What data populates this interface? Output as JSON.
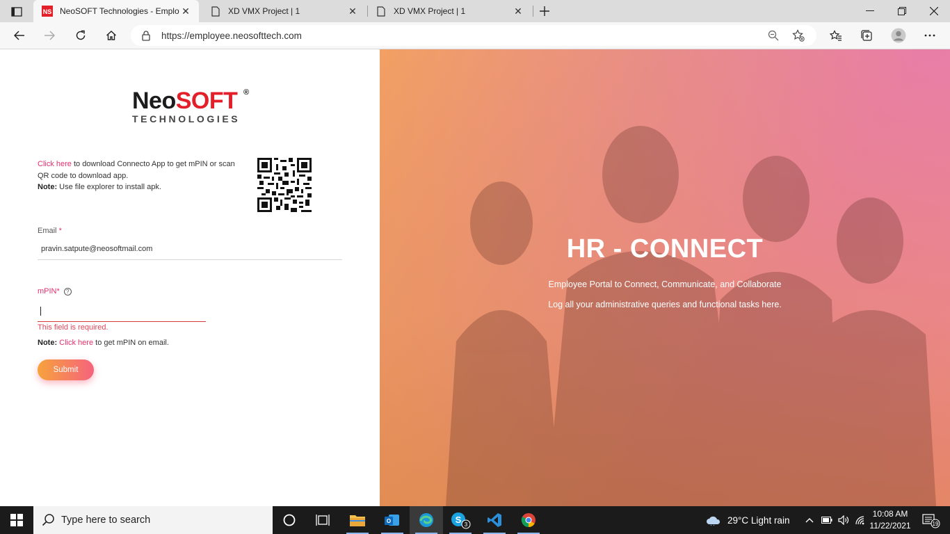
{
  "browser": {
    "tabs": [
      {
        "title": "NeoSOFT Technologies - Employ",
        "favicon_text": "NS",
        "active": true
      },
      {
        "title": "XD VMX Project | 1",
        "active": false
      },
      {
        "title": "XD VMX Project | 1",
        "active": false
      }
    ],
    "url": "https://employee.neosofttech.com"
  },
  "logo": {
    "brand_a": "Neo",
    "brand_b": "SOFT",
    "reg": "®",
    "tagline": "TECHNOLOGIES"
  },
  "download_info": {
    "link": "Click here",
    "text": " to download Connecto App to get mPIN or scan QR code to download app.",
    "note_label": "Note:",
    "note_text": " Use file explorer to install apk."
  },
  "form": {
    "email_label": "Email",
    "required_mark": " *",
    "email_value": "pravin.satpute@neosoftmail.com",
    "mpin_label": "mPIN",
    "help_glyph": "?",
    "error": "This field is required.",
    "note_label": "Note:",
    "note_link": "Click here",
    "note_text": " to get mPIN on email.",
    "submit": "Submit"
  },
  "hero": {
    "title": "HR - CONNECT",
    "subtitle1": "Employee Portal to Connect, Communicate, and Collaborate",
    "subtitle2": "Log all your administrative queries and functional tasks here."
  },
  "taskbar": {
    "search_placeholder": "Type here to search",
    "skype_badge": "3",
    "weather": "29°C  Light rain",
    "time": "10:08 AM",
    "date": "11/22/2021",
    "notifications": "19"
  },
  "colors": {
    "accent": "#e5306b",
    "brand_red": "#e3202a",
    "taskbar": "#1b1b1b"
  }
}
